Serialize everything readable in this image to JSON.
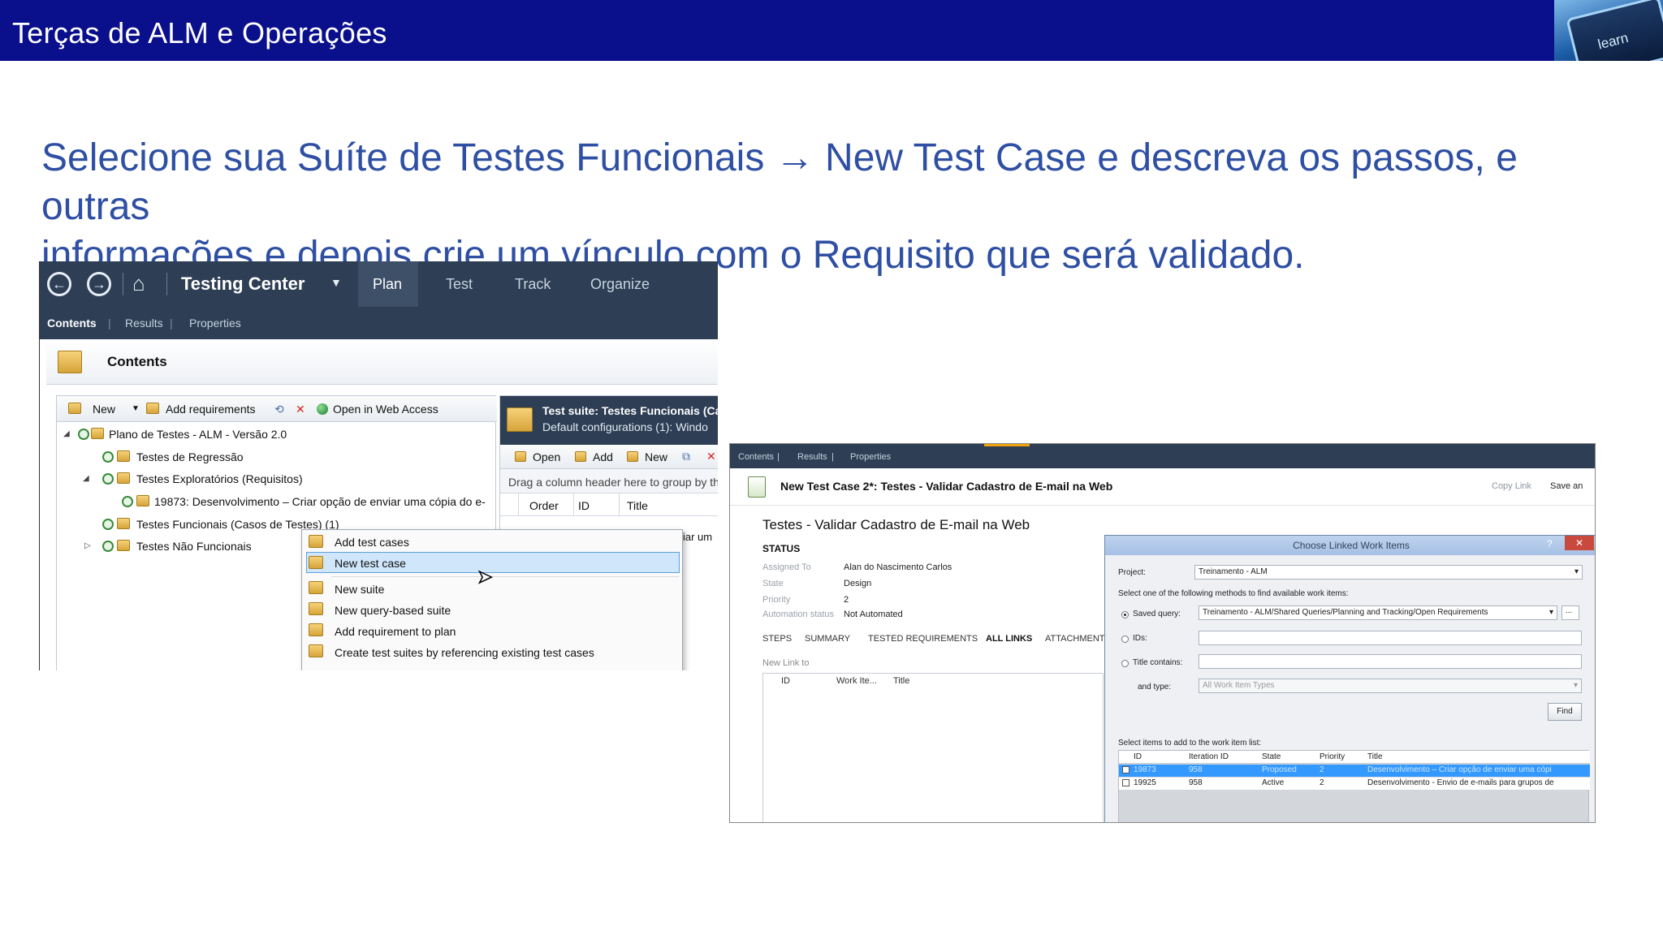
{
  "banner": {
    "title": "Terças de ALM e Operações",
    "logo_text": "learn"
  },
  "heading": {
    "line1_before": "Selecione sua Suíte de Testes Funcionais",
    "arrow": "→",
    "line1_after": "New Test Case e descreva os passos, e outras",
    "line2": "informações e depois crie um vínculo com o Requisito que será validado."
  },
  "testing_center": {
    "title": "Testing Center",
    "tabs": [
      "Plan",
      "Test",
      "Track",
      "Organize"
    ],
    "subtabs": [
      "Contents",
      "Results",
      "Properties"
    ],
    "contents_title": "Contents",
    "toolbar": {
      "new": "New",
      "add_requirements": "Add requirements",
      "open_web": "Open in Web Access"
    },
    "tree": [
      "Plano de Testes - ALM - Versão 2.0",
      "Testes de Regressão",
      "Testes Exploratórios (Requisitos)",
      "19873: Desenvolvimento – Criar opção de enviar uma cópia do e-",
      "Testes Funcionais (Casos de Testes) (1)",
      "Testes Não Funcionais"
    ],
    "suite": {
      "line1": "Test suite:  Testes Funcionais (Ca",
      "line2": "Default configurations (1):  Windo",
      "toolbar": [
        "Open",
        "Add",
        "New"
      ],
      "group_hint": "Drag a column header here to group by th",
      "columns": [
        "Order",
        "ID",
        "Title"
      ],
      "peek": "iar um"
    },
    "context_menu": [
      "Add test cases",
      "New test case",
      "New suite",
      "New query-based suite",
      "Add requirement to plan",
      "Create test suites by referencing existing test cases"
    ]
  },
  "test_case": {
    "subtabs": [
      "Contents",
      "Results",
      "Properties"
    ],
    "window_title": "New Test Case 2*: Testes - Validar Cadastro de E-mail na Web",
    "actions": [
      "Copy Link",
      "Save an"
    ],
    "name": "Testes - Validar Cadastro de E-mail na Web",
    "status_label": "STATUS",
    "fields": [
      {
        "label": "Assigned To",
        "value": "Alan do Nascimento Carlos"
      },
      {
        "label": "State",
        "value": "Design"
      },
      {
        "label": "Priority",
        "value": "2"
      },
      {
        "label": "Automation status",
        "value": "Not Automated"
      }
    ],
    "tabs": [
      "STEPS",
      "SUMMARY",
      "TESTED REQUIREMENTS",
      "ALL LINKS",
      "ATTACHMENTS"
    ],
    "links_toolbar": "New   Link to",
    "links_columns": [
      "ID",
      "Work Ite...",
      "Title"
    ]
  },
  "dialog": {
    "title": "Choose Linked Work Items",
    "help": "?",
    "close": "✕",
    "project_label": "Project:",
    "project_value": "Treinamento - ALM",
    "method_hint": "Select one of the following methods to find available work items:",
    "saved_query_label": "Saved query:",
    "saved_query_value": "Treinamento - ALM/Shared Queries/Planning and Tracking/Open Requirements",
    "ids_label": "IDs:",
    "title_contains_label": "Title contains:",
    "and_type_label": "and type:",
    "and_type_value": "All Work Item Types",
    "find_label": "Find",
    "select_hint": "Select items to add to the work item list:",
    "columns": [
      "ID",
      "Iteration ID",
      "State",
      "Priority",
      "Title"
    ],
    "rows": [
      {
        "id": "19873",
        "iteration": "958",
        "state": "Proposed",
        "priority": "2",
        "title": "Desenvolvimento – Criar opção de enviar uma cópi"
      },
      {
        "id": "19925",
        "iteration": "958",
        "state": "Active",
        "priority": "2",
        "title": "Desenvolvimento - Envio de e-mails para grupos de"
      }
    ]
  },
  "colors": {
    "banner": "#0a0f8c",
    "heading": "#2e4fa3",
    "header_dark": "#2d3e55",
    "accent": "#f0a30a"
  }
}
